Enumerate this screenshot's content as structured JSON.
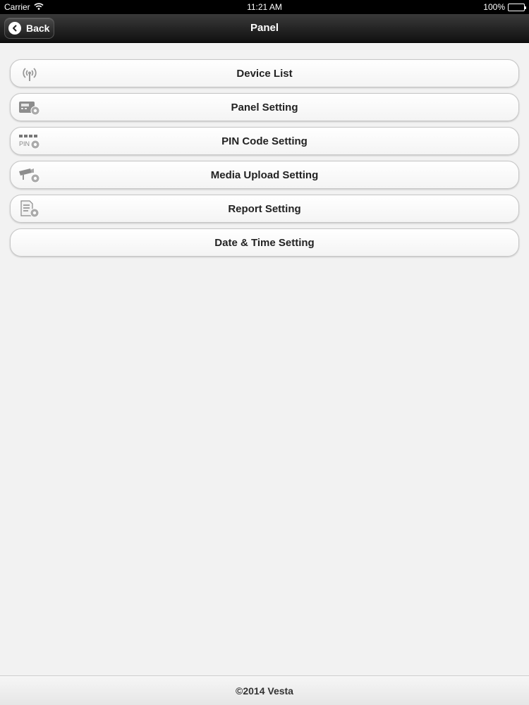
{
  "status_bar": {
    "carrier": "Carrier",
    "time": "11:21 AM",
    "battery": "100%"
  },
  "nav": {
    "back_label": "Back",
    "title": "Panel"
  },
  "menu": {
    "items": [
      {
        "label": "Device List",
        "icon": "antenna-icon"
      },
      {
        "label": "Panel Setting",
        "icon": "panel-gear-icon"
      },
      {
        "label": "PIN Code Setting",
        "icon": "pin-gear-icon"
      },
      {
        "label": "Media Upload Setting",
        "icon": "camera-gear-icon"
      },
      {
        "label": "Report Setting",
        "icon": "report-gear-icon"
      },
      {
        "label": "Date & Time Setting",
        "icon": ""
      }
    ]
  },
  "footer": {
    "text": "©2014 Vesta"
  },
  "colors": {
    "nav_bar": "#1a1a1a",
    "background": "#f2f2f2",
    "button_border": "#c6c6c6",
    "label_text": "#222222"
  }
}
